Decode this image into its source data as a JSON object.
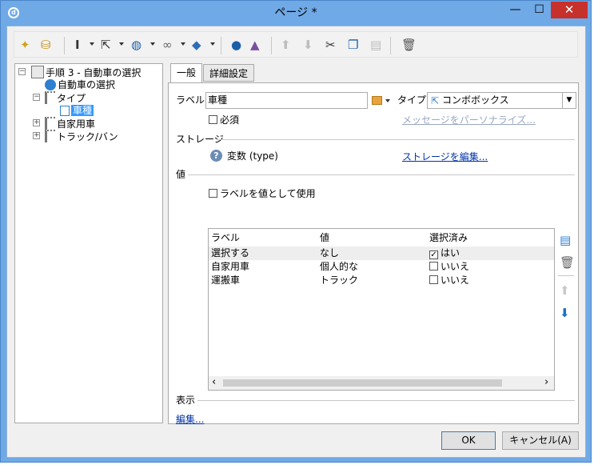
{
  "window": {
    "title": "ページ *",
    "minimize_glyph": "—",
    "maximize_glyph": "☐",
    "close_glyph": "✕"
  },
  "toolbar": {
    "icons": [
      "wand-icon",
      "database-refresh-icon",
      "text-cursor-icon",
      "cursor-gear-icon",
      "globe-icon",
      "link-icon",
      "cube-icon",
      "user-icon",
      "shapes-add-icon",
      "arrow-up-icon",
      "arrow-down-icon",
      "scissors-icon",
      "copy-icon",
      "paste-icon",
      "trash-icon"
    ]
  },
  "tree": {
    "root": "手順 3 - 自動車の選択",
    "items": [
      {
        "label": "自動車の選択"
      },
      {
        "label": "タイプ"
      },
      {
        "label": "車種",
        "selected": true
      },
      {
        "label": "自家用車"
      },
      {
        "label": "トラック/バン"
      }
    ]
  },
  "tabs": [
    {
      "label": "一般",
      "active": true
    },
    {
      "label": "詳細設定",
      "active": false
    }
  ],
  "form": {
    "label_caption": "ラベル:",
    "label_value": "車種",
    "type_caption": "タイプ:",
    "type_value": "コンボボックス",
    "required_label": "必須",
    "personalize_link": "メッセージをパーソナライズ..."
  },
  "storage": {
    "section_title": "ストレージ",
    "variable_text": "変数 (type)",
    "edit_link": "ストレージを編集..."
  },
  "values": {
    "section_title": "値",
    "use_label_checkbox": "ラベルを値として使用",
    "columns": [
      "ラベル",
      "値",
      "選択済み"
    ],
    "rows": [
      {
        "label": "選択する",
        "value": "なし",
        "selected": "はい",
        "checked": true
      },
      {
        "label": "自家用車",
        "value": "個人的な",
        "selected": "いいえ",
        "checked": false
      },
      {
        "label": "運搬車",
        "value": "トラック",
        "selected": "いいえ",
        "checked": false
      }
    ],
    "scroll_left": "‹",
    "scroll_right": "›"
  },
  "display": {
    "section_title": "表示",
    "edit_link": "編集..."
  },
  "buttons": {
    "ok": "OK",
    "cancel": "キャンセル(A)"
  },
  "colors": {
    "titlebar": "#6fa9e6",
    "close": "#c7312b",
    "selection": "#3399ff",
    "link": "#0033aa"
  }
}
